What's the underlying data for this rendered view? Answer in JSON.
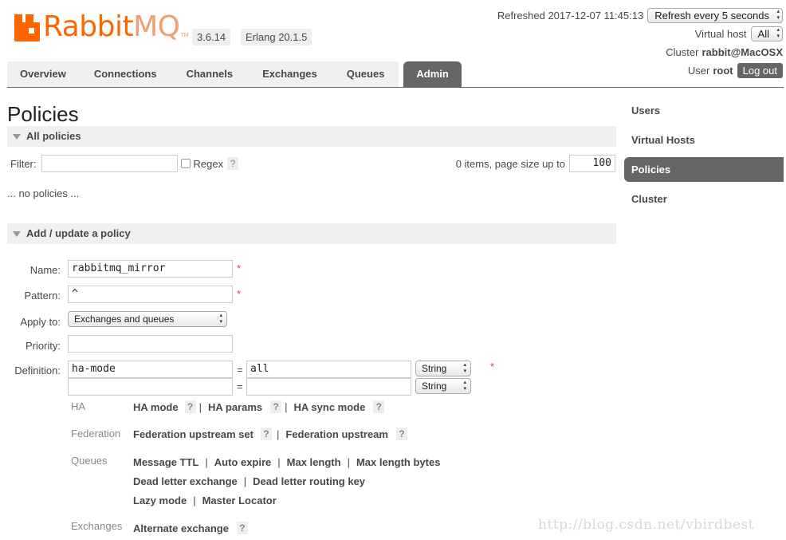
{
  "header": {
    "logo_text": "Rabbit",
    "logo_mq": "MQ",
    "logo_tm": "TM",
    "version": "3.6.14",
    "erlang": "Erlang 20.1.5",
    "refreshed": "Refreshed 2017-12-07 11:45:13",
    "refresh_select": "Refresh every 5 seconds",
    "vhost_label": "Virtual host",
    "vhost_value": "All",
    "cluster_label": "Cluster",
    "cluster_value": "rabbit@MacOSX",
    "user_label": "User",
    "user_value": "root",
    "logout": "Log out"
  },
  "tabs": [
    "Overview",
    "Connections",
    "Channels",
    "Exchanges",
    "Queues",
    "Admin"
  ],
  "active_tab": "Admin",
  "page_title": "Policies",
  "all_policies": {
    "heading": "All policies",
    "filter_label": "Filter:",
    "filter_value": "",
    "regex_label": "Regex",
    "help": "?",
    "paging_text": "0 items, page size up to",
    "page_size": "100",
    "empty_text": "... no policies ..."
  },
  "add_policy": {
    "heading": "Add / update a policy",
    "name_label": "Name:",
    "name_value": "rabbitmq_mirror",
    "pattern_label": "Pattern:",
    "pattern_value": "^",
    "apply_label": "Apply to:",
    "apply_value": "Exchanges and queues",
    "priority_label": "Priority:",
    "priority_value": "",
    "definition_label": "Definition:",
    "required": "*",
    "eq": "=",
    "def_rows": [
      {
        "key": "ha-mode",
        "value": "all",
        "type": "String"
      },
      {
        "key": "",
        "value": "",
        "type": "String"
      }
    ],
    "categories": {
      "ha": {
        "label": "HA",
        "items": [
          "HA mode",
          "HA params",
          "HA sync mode"
        ]
      },
      "federation": {
        "label": "Federation",
        "items": [
          "Federation upstream set",
          "Federation upstream"
        ]
      },
      "queues": {
        "label": "Queues",
        "line1": [
          "Message TTL",
          "Auto expire",
          "Max length",
          "Max length bytes"
        ],
        "line2": [
          "Dead letter exchange",
          "Dead letter routing key"
        ],
        "line3": [
          "Lazy mode",
          "Master Locator"
        ]
      },
      "exchanges": {
        "label": "Exchanges",
        "items": [
          "Alternate exchange"
        ]
      }
    },
    "sep": "|"
  },
  "sidebar": [
    "Users",
    "Virtual Hosts",
    "Policies",
    "Cluster"
  ],
  "watermark": "http://blog.csdn.net/vbirdbest",
  "colors": {
    "brand": "#ff6600",
    "tab_active": "#666666",
    "required": "#ff3333"
  }
}
